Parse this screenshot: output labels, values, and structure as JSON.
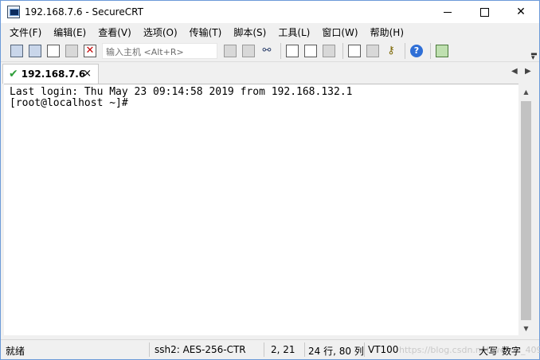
{
  "window": {
    "title": "192.168.7.6 - SecureCRT"
  },
  "menu": [
    "文件(F)",
    "编辑(E)",
    "查看(V)",
    "选项(O)",
    "传输(T)",
    "脚本(S)",
    "工具(L)",
    "窗口(W)",
    "帮助(H)"
  ],
  "toolbar": {
    "quick_connect_placeholder": "输入主机 <Alt+R>",
    "icons": [
      "connect-icon",
      "quick-connect-icon",
      "connect-tab-icon",
      "reconnect-icon",
      "disconnect-icon",
      "copy-icon",
      "paste-icon",
      "find-icon",
      "print-icon",
      "print-selection-icon",
      "print-setup-icon",
      "session-options-icon",
      "global-options-icon",
      "keymap-icon",
      "help-icon",
      "sftp-icon"
    ]
  },
  "tab": {
    "label": "192.168.7.6",
    "close": "×"
  },
  "terminal": {
    "lines": [
      "Last login: Thu May 23 09:14:58 2019 from 192.168.132.1",
      "[root@localhost ~]#"
    ]
  },
  "status": {
    "ready": "就绪",
    "protocol": "ssh2: AES-256-CTR",
    "cursor": "2,  21",
    "size": "24 行, 80 列",
    "terminal_type": "VT100",
    "caps": "大写",
    "num": "数字",
    "watermark": "https://blog.csdn.net/weixin_40948..."
  }
}
